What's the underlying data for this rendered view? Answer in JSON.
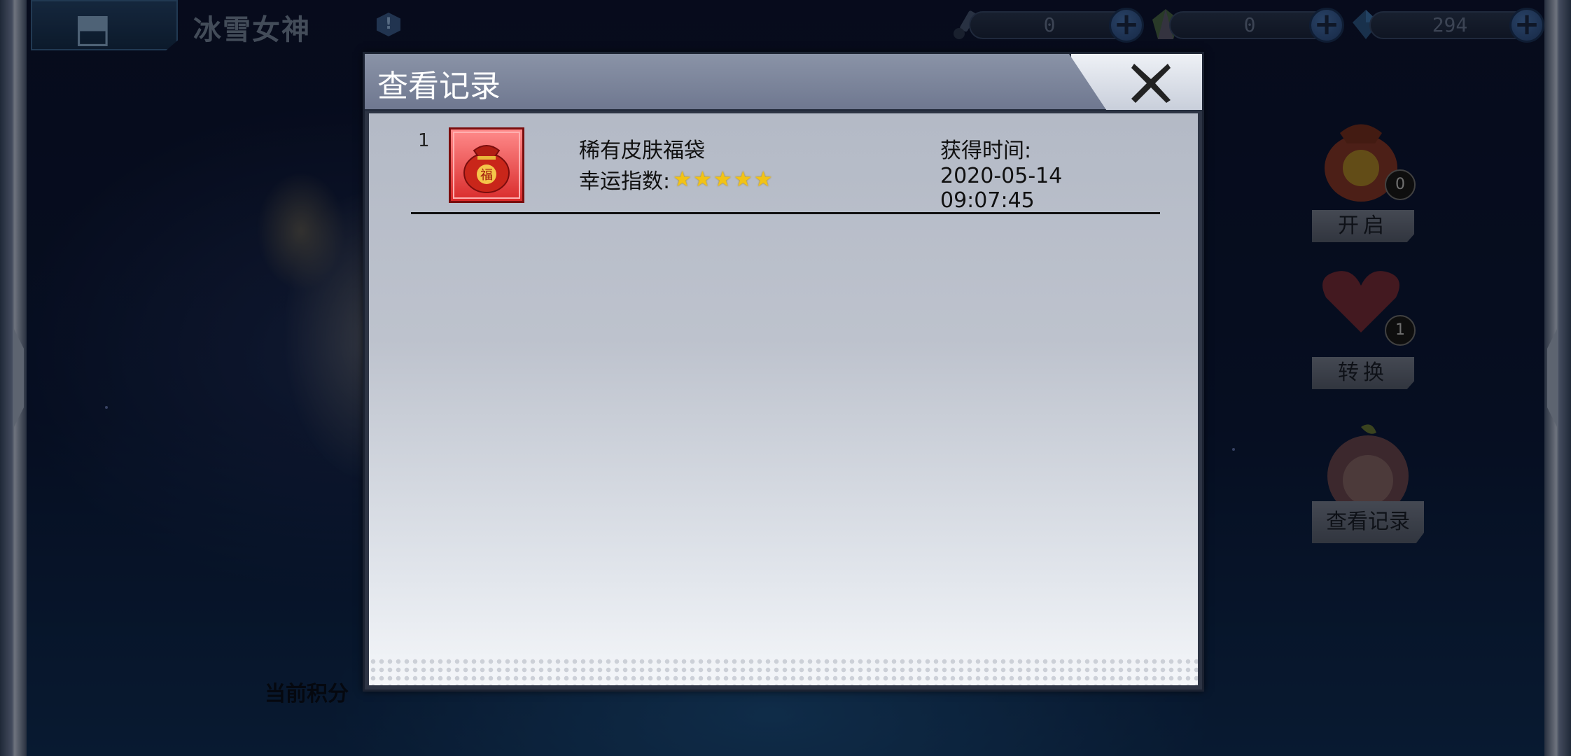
{
  "top_bar": {
    "game_title": "冰雪女神",
    "currencies": [
      {
        "icon": "key-icon",
        "value": "0"
      },
      {
        "icon": "crystal-icon",
        "value": "0"
      },
      {
        "icon": "diamond-icon",
        "value": "294"
      }
    ]
  },
  "side_panel": {
    "lucky_bag": {
      "button_label": "开启",
      "count": "0"
    },
    "heart": {
      "button_label": "转换",
      "count": "1"
    },
    "records": {
      "button_label": "查看记录"
    }
  },
  "background": {
    "score_label": "当前积分"
  },
  "modal": {
    "title": "查看记录",
    "records": [
      {
        "index": "1",
        "item_name": "稀有皮肤福袋",
        "luck_label": "幸运指数:",
        "luck_stars": 5,
        "time_label": "获得时间:",
        "time_value": "2020-05-14 09:07:45"
      }
    ]
  },
  "colors": {
    "modal_header": "#7f889d",
    "thumb_red": "#d92b2b",
    "star_yellow": "#f2c315"
  }
}
